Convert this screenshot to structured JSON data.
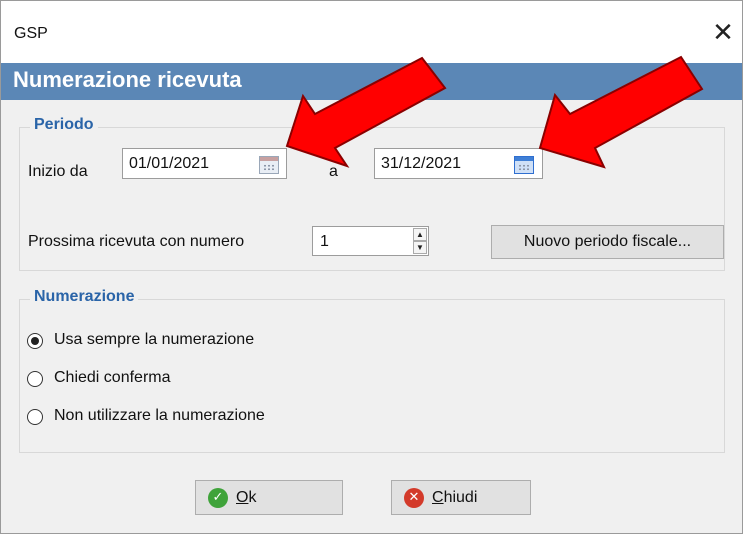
{
  "window": {
    "title": "GSP",
    "close_glyph": "✕",
    "header": "Numerazione ricevuta"
  },
  "periodo": {
    "legend": "Periodo",
    "start_label": "Inizio da",
    "start_value": "01/01/2021",
    "to_label": "a",
    "end_value": "31/12/2021",
    "next_label": "Prossima ricevuta con numero",
    "next_value": "1",
    "new_period_button": "Nuovo periodo fiscale..."
  },
  "numerazione": {
    "legend": "Numerazione",
    "options": [
      {
        "label": "Usa sempre la numerazione",
        "selected": true
      },
      {
        "label": "Chiedi conferma",
        "selected": false
      },
      {
        "label": "Non utilizzare la numerazione",
        "selected": false
      }
    ]
  },
  "buttons": {
    "ok": "Ok",
    "close": "Chiudi"
  },
  "colors": {
    "header_band": "#5b87b6",
    "legend_text": "#2a64a8",
    "annotation_arrow": "#ff0000"
  },
  "icons": {
    "calendar": "calendar-icon",
    "ok": "check-circle-icon",
    "close": "x-circle-icon"
  }
}
